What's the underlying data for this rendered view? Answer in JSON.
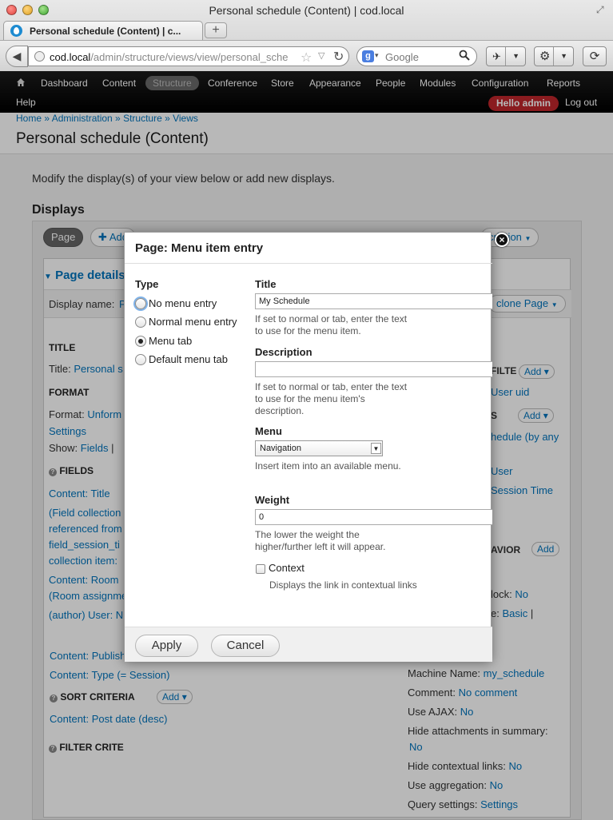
{
  "window": {
    "title": "Personal schedule (Content) | cod.local"
  },
  "tab": {
    "title": "Personal schedule (Content) | c...",
    "close": "×",
    "new_tab": "+"
  },
  "address": {
    "host": "cod.local",
    "path": "/admin/structure/views/view/personal_sche",
    "star": "☆",
    "reload": "↻"
  },
  "search": {
    "engine": "g",
    "placeholder": "Google"
  },
  "admin_menu": {
    "items": [
      "Dashboard",
      "Content",
      "Structure",
      "Conference",
      "Store",
      "Appearance",
      "People",
      "Modules",
      "Configuration",
      "Reports"
    ],
    "active": "Structure",
    "help": "Help",
    "hello": "Hello admin",
    "logout": "Log out"
  },
  "page": {
    "breadcrumb": "Home » Administration » Structure » Views",
    "title": "Personal schedule (Content)",
    "intro": "Modify the display(s) of your view below or add new displays.",
    "displays_heading": "Displays",
    "page_tab": "Page",
    "add_tab": "Add",
    "edit_description": "cription",
    "page_details": "Page details",
    "display_name_label": "Display name:",
    "display_name_value": "P",
    "clone_page": "clone Page",
    "title_section": "TITLE",
    "title_label": "Title:",
    "title_value": "Personal s",
    "format_section": "FORMAT",
    "format_label": "Format:",
    "format_value": "Unform",
    "settings": "Settings",
    "show_label": "Show:",
    "show_value": "Fields",
    "fields_section": "FIELDS",
    "fields": [
      "Content: Title",
      "(Field collection",
      "referenced from",
      "field_session_ti",
      "collection item:",
      "Content: Room",
      "(Room assignme",
      "(author) User: N"
    ],
    "filter_section": "FILTER CRITE",
    "filters": [
      "Content: Publish",
      "Content: Type (= Session)"
    ],
    "sort_section": "SORT CRITERIA",
    "sorts": [
      "Content: Post date (desc)"
    ],
    "add": "Add",
    "right_col": {
      "filter_h": "FILTE",
      "user_uid": "User uid",
      "s_h": "S",
      "schedule_any": "hedule (by any",
      "user": "User",
      "session_time": "Session Time",
      "behavior_h": "AVIOR",
      "block": "lock:",
      "block_val": "No",
      "e_label": "e:",
      "basic": "Basic",
      "machine_name_label": "Machine Name:",
      "machine_name": "my_schedule",
      "comment_label": "Comment:",
      "comment": "No comment",
      "ajax_label": "Use AJAX:",
      "ajax": "No",
      "hide_attach_label": "Hide attachments in summary:",
      "hide_attach": "No",
      "hide_ctx_label": "Hide contextual links:",
      "hide_ctx": "No",
      "aggregation_label": "Use aggregation:",
      "aggregation": "No",
      "query_label": "Query settings:",
      "query": "Settings"
    }
  },
  "modal": {
    "title": "Page: Menu item entry",
    "close": "×",
    "type_label": "Type",
    "types": [
      "No menu entry",
      "Normal menu entry",
      "Menu tab",
      "Default menu tab"
    ],
    "selected_type": "Menu tab",
    "title_label": "Title",
    "title_value": "My Schedule",
    "title_help": "If set to normal or tab, enter the text to use for the menu item.",
    "description_label": "Description",
    "description_value": "",
    "description_help": "If set to normal or tab, enter the text to use for the menu item's description.",
    "menu_label": "Menu",
    "menu_value": "Navigation",
    "menu_help": "Insert item into an available menu.",
    "weight_label": "Weight",
    "weight_value": "0",
    "weight_help": "The lower the weight the higher/further left it will appear.",
    "context_label": "Context",
    "context_help": "Displays the link in contextual links",
    "apply": "Apply",
    "cancel": "Cancel"
  }
}
